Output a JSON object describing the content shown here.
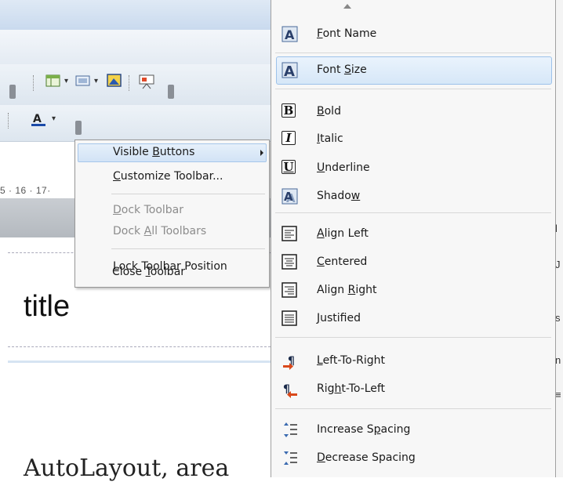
{
  "background": {
    "ruler_text": "5 · 16 · 17·",
    "slide_title": "title",
    "slide_body": "AutoLayout, area",
    "right_cut_chars": [
      "l",
      "J",
      "s",
      "n",
      "≡"
    ]
  },
  "context_menu": {
    "items": [
      {
        "label_pre": "Visible ",
        "label_u": "B",
        "label_post": "uttons",
        "has_submenu": true,
        "enabled": true
      },
      {
        "label_pre": "",
        "label_u": "C",
        "label_post": "ustomize Toolbar...",
        "enabled": true
      },
      {
        "label_pre": "",
        "label_u": "D",
        "label_post": "ock Toolbar",
        "enabled": false
      },
      {
        "label_pre": "Dock ",
        "label_u": "A",
        "label_post": "ll Toolbars",
        "enabled": false
      },
      {
        "label_pre": "",
        "label_u": "L",
        "label_post": "ock Toolbar Position",
        "enabled": true
      },
      {
        "label_pre": "Close ",
        "label_u": "T",
        "label_post": "oolbar",
        "enabled": true
      }
    ]
  },
  "visible_buttons_menu": {
    "items": [
      {
        "icon": "font-name-icon",
        "label_pre": "",
        "label_u": "F",
        "label_post": "ont Name",
        "checked": true
      },
      {
        "icon": "font-size-icon",
        "label_pre": "Font ",
        "label_u": "S",
        "label_post": "ize",
        "checked": true,
        "highlighted": true
      },
      {
        "icon": "bold-icon",
        "label_pre": "",
        "label_u": "B",
        "label_post": "old",
        "checked": true
      },
      {
        "icon": "italic-icon",
        "label_pre": "",
        "label_u": "I",
        "label_post": "talic",
        "checked": true
      },
      {
        "icon": "underline-icon",
        "label_pre": "",
        "label_u": "U",
        "label_post": "nderline",
        "checked": true
      },
      {
        "icon": "shadow-icon",
        "label_pre": "Shado",
        "label_u": "w",
        "label_post": "",
        "checked": true
      },
      {
        "icon": "align-left-icon",
        "label_pre": "",
        "label_u": "A",
        "label_post": "lign Left",
        "checked": true
      },
      {
        "icon": "align-center-icon",
        "label_pre": "",
        "label_u": "C",
        "label_post": "entered",
        "checked": true
      },
      {
        "icon": "align-right-icon",
        "label_pre": "Align ",
        "label_u": "R",
        "label_post": "ight",
        "checked": true
      },
      {
        "icon": "justify-icon",
        "label_pre": "",
        "label_u": "J",
        "label_post": "ustified",
        "checked": true
      },
      {
        "icon": "left-to-right-icon",
        "label_pre": "",
        "label_u": "L",
        "label_post": "eft-To-Right",
        "checked": false
      },
      {
        "icon": "right-to-left-icon",
        "label_pre": "Rig",
        "label_u": "h",
        "label_post": "t-To-Left",
        "checked": false
      },
      {
        "icon": "increase-spacing-icon",
        "label_pre": "Increase S",
        "label_u": "p",
        "label_post": "acing",
        "checked": false
      },
      {
        "icon": "decrease-spacing-icon",
        "label_pre": "",
        "label_u": "D",
        "label_post": "ecrease Spacing",
        "checked": false
      }
    ]
  },
  "colors": {
    "highlight": "#d6e7f8",
    "highlight_border": "#9dc2ea",
    "disabled_text": "#8c8c8c",
    "menu_bg": "#f7f7f7"
  }
}
